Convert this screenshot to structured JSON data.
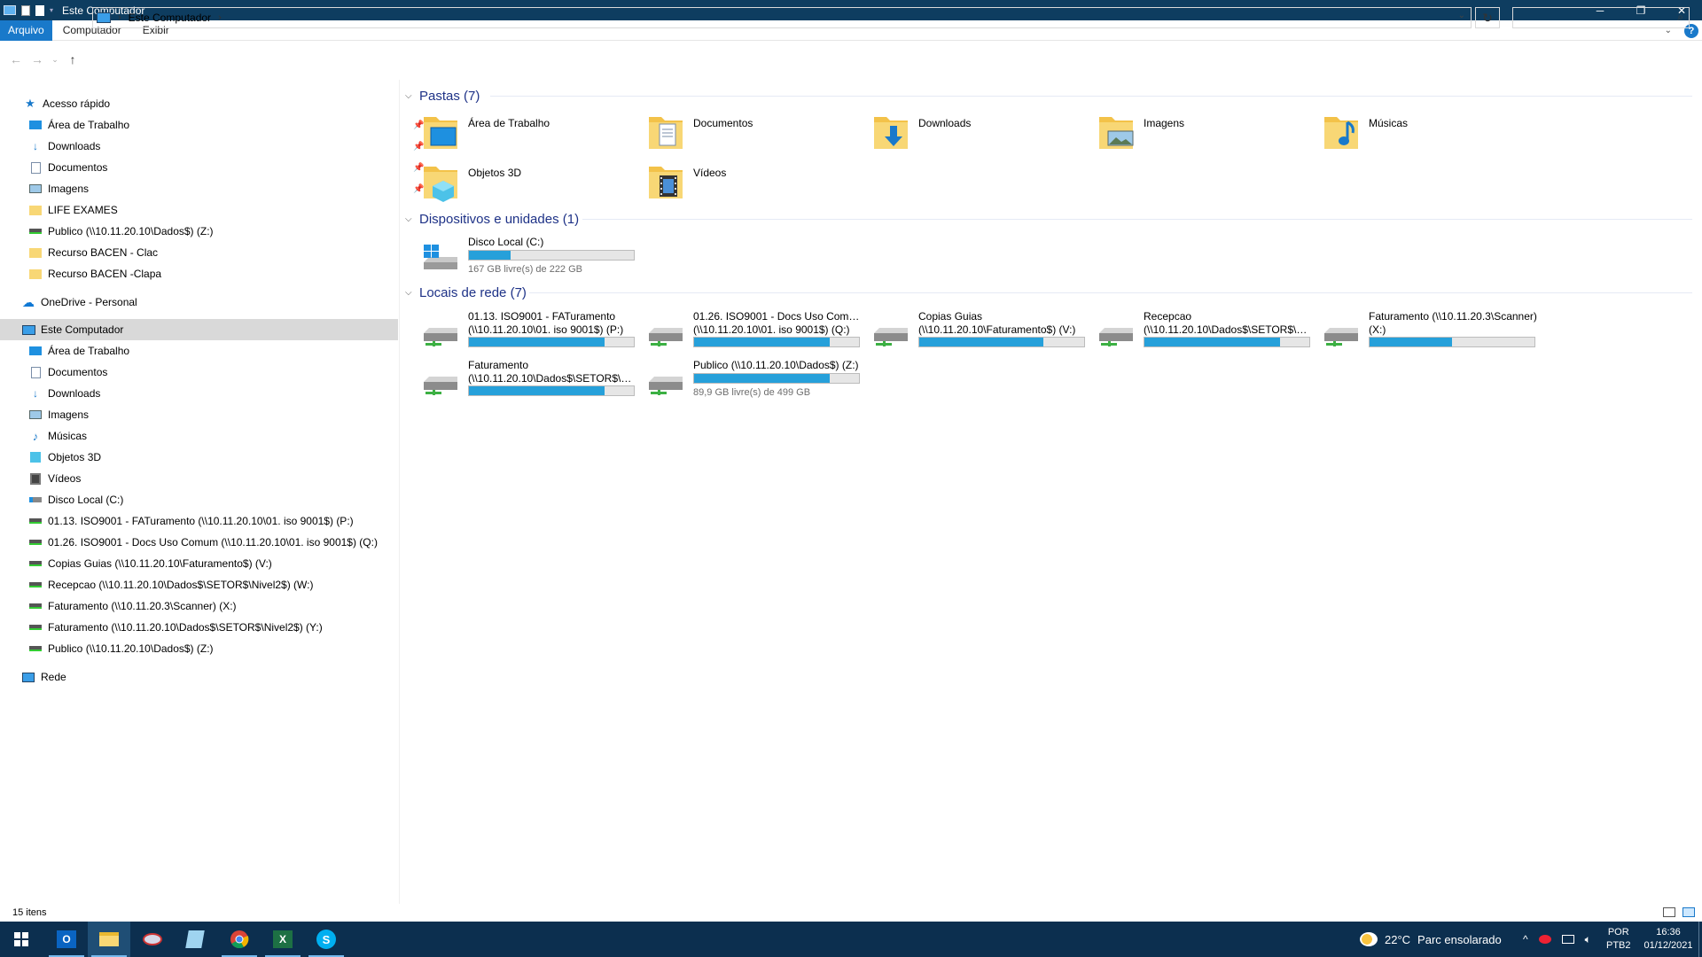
{
  "window": {
    "title": "Este Computador",
    "controls": {
      "minimize": "─",
      "maximize": "❐",
      "close": "✕"
    }
  },
  "ribbon": {
    "tabs": [
      {
        "label": "Arquivo",
        "active": true
      },
      {
        "label": "Computador",
        "active": false
      },
      {
        "label": "Exibir",
        "active": false
      }
    ],
    "help": "?"
  },
  "address": {
    "crumb": "Este Computador",
    "search_placeholder": ""
  },
  "sidebar": {
    "quick_access": {
      "label": "Acesso rápido",
      "items": [
        {
          "label": "Área de Trabalho",
          "icon": "desktop-icon",
          "pinned": true
        },
        {
          "label": "Downloads",
          "icon": "download-icon",
          "pinned": true
        },
        {
          "label": "Documentos",
          "icon": "document-icon",
          "pinned": true
        },
        {
          "label": "Imagens",
          "icon": "image-icon",
          "pinned": true
        },
        {
          "label": "LIFE EXAMES",
          "icon": "folder-icon",
          "pinned": false
        },
        {
          "label": "Publico (\\\\10.11.20.10\\Dados$) (Z:)",
          "icon": "network-drive-icon",
          "pinned": false
        },
        {
          "label": "Recurso BACEN - Clac",
          "icon": "folder-icon",
          "pinned": false
        },
        {
          "label": "Recurso BACEN -Clapa",
          "icon": "folder-icon",
          "pinned": false
        }
      ]
    },
    "onedrive": {
      "label": "OneDrive - Personal"
    },
    "this_pc": {
      "label": "Este Computador",
      "items": [
        {
          "label": "Área de Trabalho",
          "icon": "desktop-icon"
        },
        {
          "label": "Documentos",
          "icon": "document-icon"
        },
        {
          "label": "Downloads",
          "icon": "download-icon"
        },
        {
          "label": "Imagens",
          "icon": "image-icon"
        },
        {
          "label": "Músicas",
          "icon": "music-icon"
        },
        {
          "label": "Objetos 3D",
          "icon": "cube-icon"
        },
        {
          "label": "Vídeos",
          "icon": "video-icon"
        },
        {
          "label": "Disco Local (C:)",
          "icon": "local-disk-icon"
        },
        {
          "label": "01.13. ISO9001 - FATuramento (\\\\10.11.20.10\\01. iso 9001$) (P:)",
          "icon": "network-drive-icon"
        },
        {
          "label": "01.26. ISO9001 - Docs Uso Comum (\\\\10.11.20.10\\01. iso 9001$) (Q:)",
          "icon": "network-drive-icon"
        },
        {
          "label": "Copias Guias (\\\\10.11.20.10\\Faturamento$) (V:)",
          "icon": "network-drive-icon"
        },
        {
          "label": "Recepcao (\\\\10.11.20.10\\Dados$\\SETOR$\\Nivel2$) (W:)",
          "icon": "network-drive-icon"
        },
        {
          "label": "Faturamento (\\\\10.11.20.3\\Scanner) (X:)",
          "icon": "network-drive-icon"
        },
        {
          "label": "Faturamento (\\\\10.11.20.10\\Dados$\\SETOR$\\Nivel2$) (Y:)",
          "icon": "network-drive-icon"
        },
        {
          "label": "Publico (\\\\10.11.20.10\\Dados$) (Z:)",
          "icon": "network-drive-icon"
        }
      ]
    },
    "network": {
      "label": "Rede"
    }
  },
  "content": {
    "folders_header": "Pastas (7)",
    "folders": [
      {
        "name": "Área de Trabalho",
        "icon": "desktop-folder-icon"
      },
      {
        "name": "Documentos",
        "icon": "documents-folder-icon"
      },
      {
        "name": "Downloads",
        "icon": "downloads-folder-icon"
      },
      {
        "name": "Imagens",
        "icon": "pictures-folder-icon"
      },
      {
        "name": "Músicas",
        "icon": "music-folder-icon"
      },
      {
        "name": "Objetos 3D",
        "icon": "3d-objects-folder-icon"
      },
      {
        "name": "Vídeos",
        "icon": "videos-folder-icon"
      }
    ],
    "devices_header": "Dispositivos e unidades (1)",
    "devices": [
      {
        "name": "Disco Local (C:)",
        "free": "167 GB livre(s) de 222 GB",
        "used_fraction": 0.25
      }
    ],
    "network_header": "Locais de rede (7)",
    "network_locations": [
      {
        "line1": "01.13. ISO9001 - FATuramento",
        "line2": "(\\\\10.11.20.10\\01. iso 9001$) (P:)",
        "used_fraction": 0.82,
        "free": ""
      },
      {
        "line1": "01.26. ISO9001 - Docs Uso Comum",
        "line2": "(\\\\10.11.20.10\\01. iso 9001$) (Q:)",
        "used_fraction": 0.82,
        "free": ""
      },
      {
        "line1": "Copias Guias",
        "line2": "(\\\\10.11.20.10\\Faturamento$) (V:)",
        "used_fraction": 0.75,
        "free": ""
      },
      {
        "line1": "Recepcao",
        "line2": "(\\\\10.11.20.10\\Dados$\\SETOR$\\Ni...",
        "used_fraction": 0.82,
        "free": ""
      },
      {
        "line1": "Faturamento (\\\\10.11.20.3\\Scanner)",
        "line2": "(X:)",
        "used_fraction": 0.5,
        "free": ""
      },
      {
        "line1": "Faturamento",
        "line2": "(\\\\10.11.20.10\\Dados$\\SETOR$\\Ni...",
        "used_fraction": 0.82,
        "free": ""
      },
      {
        "line1": "Publico (\\\\10.11.20.10\\Dados$) (Z:)",
        "line2": "",
        "used_fraction": 0.82,
        "free": "89,9 GB livre(s) de 499 GB"
      }
    ]
  },
  "status": {
    "items": "15 itens"
  },
  "taskbar": {
    "apps": [
      {
        "name": "start-button",
        "state": "normal"
      },
      {
        "name": "outlook-icon",
        "state": "open"
      },
      {
        "name": "file-explorer-icon",
        "state": "active"
      },
      {
        "name": "tracking-app-icon",
        "state": "normal"
      },
      {
        "name": "notepad-icon",
        "state": "normal"
      },
      {
        "name": "chrome-icon",
        "state": "open"
      },
      {
        "name": "excel-icon",
        "state": "open"
      },
      {
        "name": "skype-icon",
        "state": "open"
      }
    ],
    "weather": {
      "temp": "22°C",
      "desc": "Parc ensolarado"
    },
    "lang": {
      "line1": "POR",
      "line2": "PTB2"
    },
    "clock": {
      "time": "16:36",
      "date": "01/12/2021"
    }
  },
  "colors": {
    "accent": "#1979ca",
    "taskbar": "#0c2f4f",
    "titlebar": "#0e3d60",
    "usage_bar": "#26a0da",
    "group_header": "#1e3287"
  }
}
